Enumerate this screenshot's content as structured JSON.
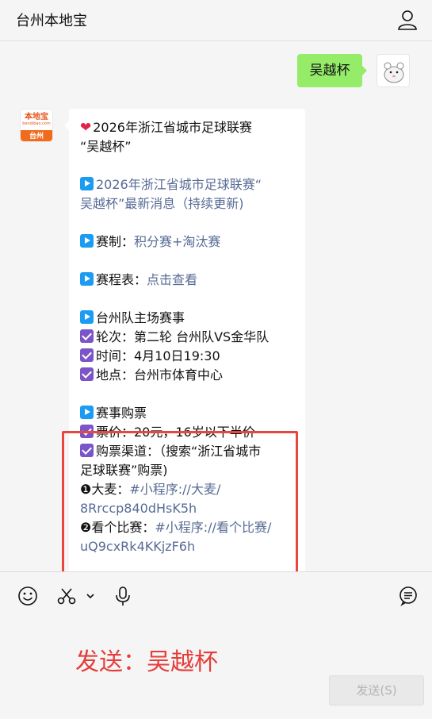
{
  "header": {
    "title": "台州本地宝"
  },
  "chat": {
    "user_message": "吴越杯",
    "bot_avatar": {
      "logo": "本地宝",
      "logo_sub": "bendibao.com",
      "city": "台州"
    },
    "bot_message": {
      "title_line1": "2026年浙江省城市足球联赛",
      "title_line2": "“吴越杯”",
      "news_link_line1": "2026年浙江省城市足球联赛“",
      "news_link_line2": "吴越杯”最新消息（持续更新)",
      "format_label": "赛制：",
      "format_value": "积分赛+淘汰赛",
      "schedule_label": "赛程表：",
      "schedule_link": "点击查看",
      "home_title": "台州队主场赛事",
      "round": "轮次：第二轮 台州队VS金华队",
      "time": "时间：4月10日19:30",
      "venue": "地点：台州市体育中心",
      "ticket_title": "赛事购票",
      "price": "票价：20元，16岁以下半价",
      "channel_line1": "购票渠道：（搜索“浙江省城市",
      "channel_line2": "足球联赛”购票)",
      "damai_label": "❶大麦：",
      "damai_link_line1": "#小程序://大麦/",
      "damai_link_line2": "8Rrccp840dHsK5h",
      "kgbs_label": "❷看个比赛：",
      "kgbs_link_line1": "#小程序://看个比赛/",
      "kgbs_link_line2": "uQ9cxRk4KKjzF6h"
    }
  },
  "input": {
    "text": "发送：吴越杯",
    "send_label": "发送(S)"
  },
  "colors": {
    "accent_red": "#e53d3a",
    "user_bubble": "#95ec69",
    "link": "#576b95"
  }
}
